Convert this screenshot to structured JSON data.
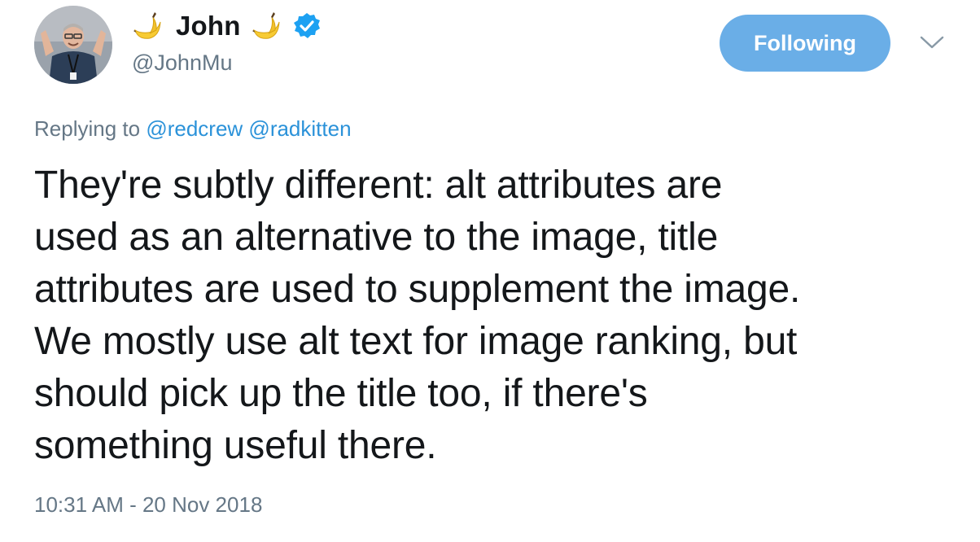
{
  "user": {
    "display_name": "John",
    "handle": "@JohnMu",
    "verified": true,
    "name_emoji": "banana"
  },
  "follow_button": {
    "label": "Following",
    "color": "#6aaee7"
  },
  "reply": {
    "prefix": "Replying to",
    "mentions": [
      "@redcrew",
      "@radkitten"
    ]
  },
  "tweet": {
    "lines": [
      "They're subtly different: alt attributes are",
      "used as an alternative to the image, title",
      "attributes are used to supplement the image.",
      "We mostly use alt text for image ranking, but",
      "should pick up the title too, if there's",
      "something useful there."
    ]
  },
  "timestamp": "10:31 AM - 20 Nov 2018",
  "colors": {
    "link": "#2b92d9",
    "secondary_text": "#657786",
    "verified_badge": "#1da1f2"
  },
  "icons": {
    "verified": "verified-badge-icon",
    "menu": "chevron-down-icon",
    "emoji": "banana-emoji-icon"
  }
}
